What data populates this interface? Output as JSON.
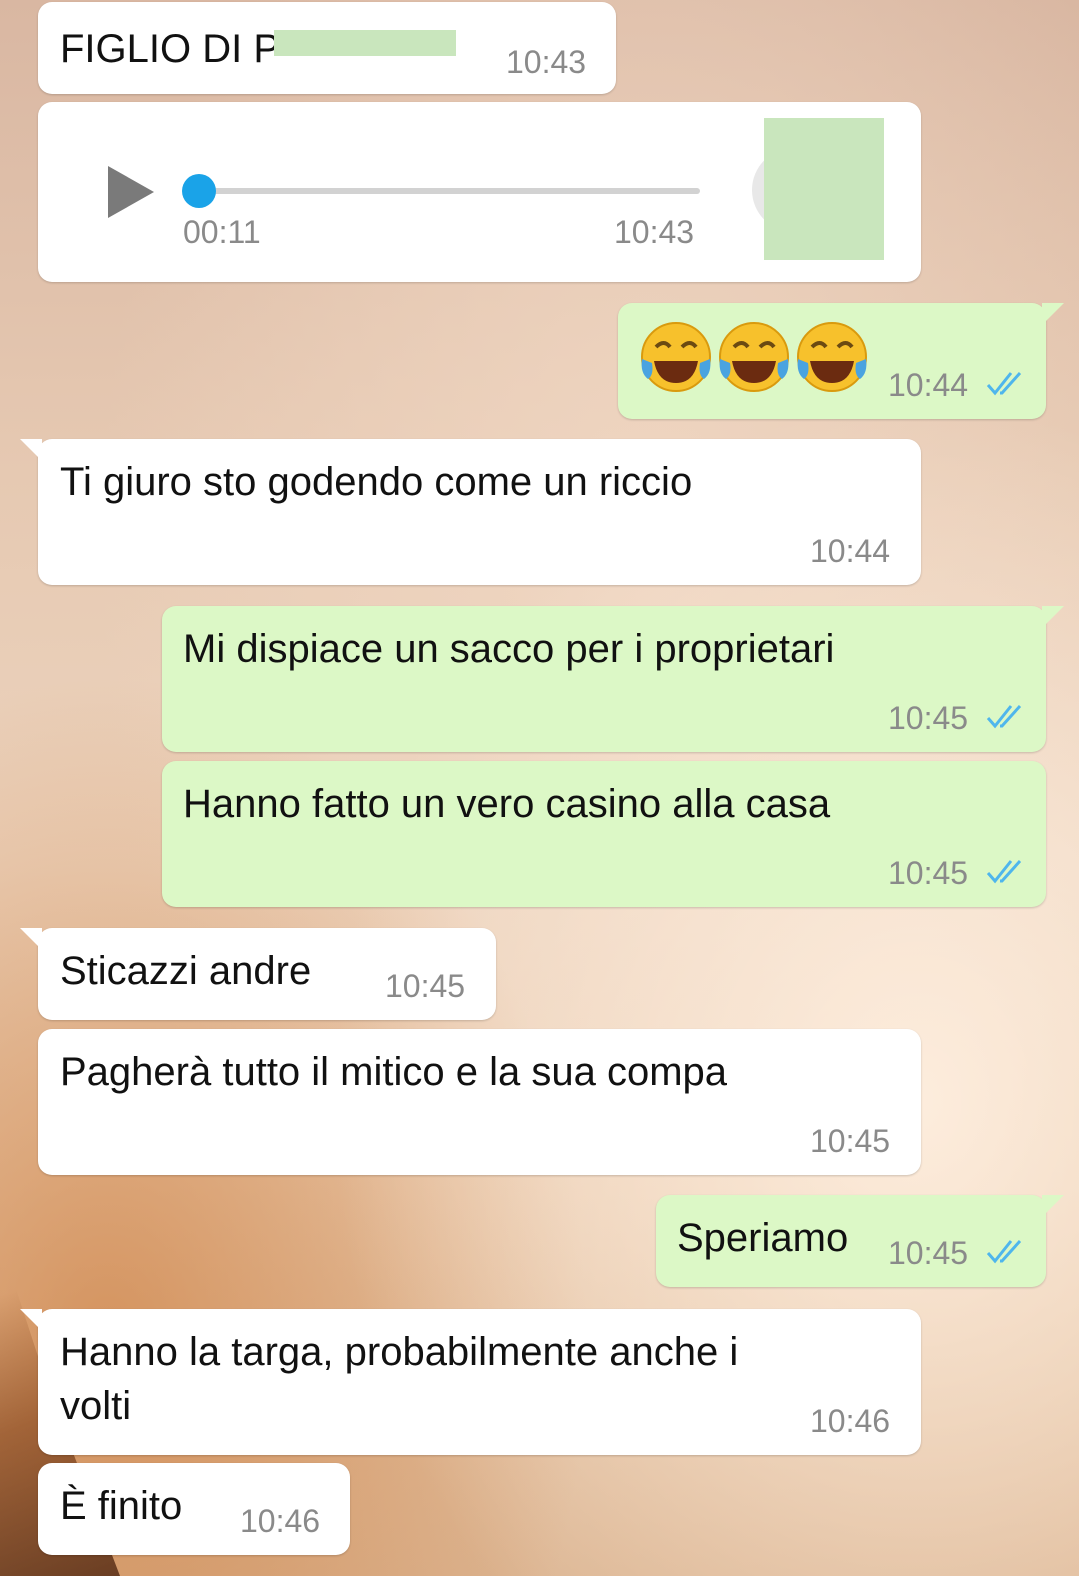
{
  "messages": [
    {
      "id": "m1",
      "dir": "in",
      "text": "FIGLIO DI P",
      "time": "10:43"
    },
    {
      "id": "m2",
      "dir": "in",
      "type": "voice",
      "duration": "00:11",
      "time": "10:43",
      "progress": 0.0
    },
    {
      "id": "m3",
      "dir": "out",
      "emoji": "😂😂😂",
      "time": "10:44",
      "status": "read"
    },
    {
      "id": "m4",
      "dir": "in",
      "text": "Ti giuro sto godendo come un riccio",
      "time": "10:44"
    },
    {
      "id": "m5",
      "dir": "out",
      "text": "Mi dispiace un sacco per i proprietari",
      "time": "10:45",
      "status": "read"
    },
    {
      "id": "m6",
      "dir": "out",
      "text": "Hanno fatto un vero casino alla casa",
      "time": "10:45",
      "status": "read"
    },
    {
      "id": "m7",
      "dir": "in",
      "text": "Sticazzi andre",
      "time": "10:45"
    },
    {
      "id": "m8",
      "dir": "in",
      "text": "Pagherà tutto il mitico e la sua compa",
      "time": "10:45"
    },
    {
      "id": "m9",
      "dir": "out",
      "text": "Speriamo",
      "time": "10:45",
      "status": "read"
    },
    {
      "id": "m10",
      "dir": "in",
      "lines": [
        "Hanno la targa, probabilmente anche i",
        "volti"
      ],
      "time": "10:46"
    },
    {
      "id": "m11",
      "dir": "in",
      "text": "È finito",
      "time": "10:46"
    }
  ],
  "colors": {
    "incoming_bubble": "#ffffff",
    "outgoing_bubble": "#dcf8c6",
    "timestamp": "#8a8a8a",
    "read_ticks": "#4fb6ec",
    "voice_accent": "#1aa3e8",
    "redaction": "#c9e6bd"
  },
  "icons": {
    "play": "play-icon",
    "read_status": "double-check-icon",
    "emoji": "face-with-tears-of-joy"
  }
}
